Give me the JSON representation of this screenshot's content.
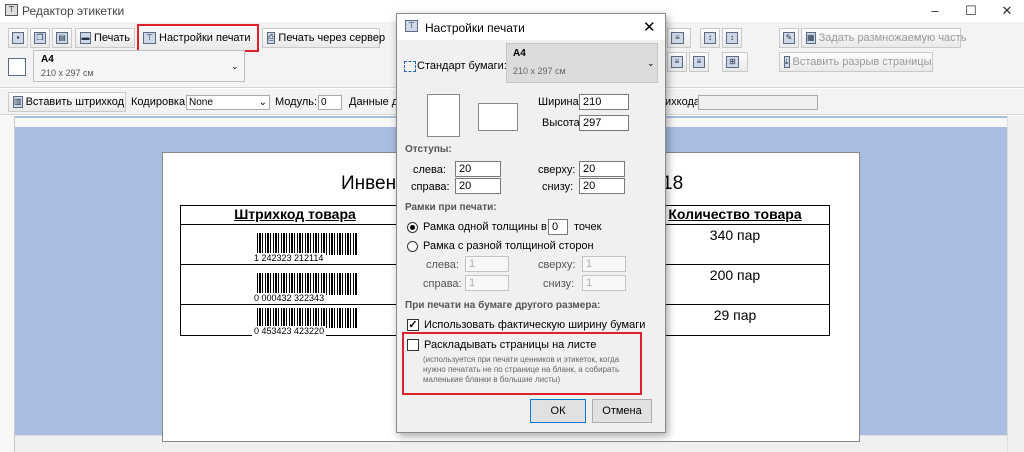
{
  "window": {
    "title": "Редактор этикетки",
    "controls": [
      "–",
      "☐",
      "✕"
    ]
  },
  "toolbar": {
    "print_label": "Печать",
    "print_settings_label": "Настройки печати",
    "print_server_label": "Печать через сервер",
    "paper_name": "A4",
    "paper_size": "210 x 297 см",
    "set_repeat_label": "Задать размножаемую часть",
    "insert_break_label": "Вставить разрыв страницы"
  },
  "toolbar2": {
    "insert_barcode_label": "Вставить штрихкод",
    "encoding_label": "Кодировка:",
    "encoding_value": "None",
    "module_label": "Модуль:",
    "module_value": "0",
    "data_label": "Данные д",
    "barcode_data_label": "ихкода:"
  },
  "document": {
    "title_left": "Инвент",
    "title_right": "18",
    "columns": [
      "Штрихкод товара",
      "Количество товара"
    ],
    "rows": [
      {
        "barcode": "1 242323 212114",
        "qty": "340 пар"
      },
      {
        "barcode": "0 000432 322343",
        "qty": "200 пар"
      },
      {
        "barcode": "0 453423 423220",
        "qty": "29 пар"
      }
    ]
  },
  "dialog": {
    "title": "Настройки печати",
    "paper_standard_label": "Стандарт бумаги:",
    "paper_name": "A4",
    "paper_size": "210 x 297 см",
    "width_label": "Ширина:",
    "width_value": "210",
    "height_label": "Высота:",
    "height_value": "297",
    "margins_section": "Отступы:",
    "left_label": "слева:",
    "left_value": "20",
    "top_label": "сверху:",
    "top_value": "20",
    "right_label": "справа:",
    "right_value": "20",
    "bottom_label": "снизу:",
    "bottom_value": "20",
    "frames_section": "Рамки при печати:",
    "frame_single_label": "Рамка одной толщины в",
    "frame_single_value": "0",
    "frame_single_unit": "точек",
    "frame_multi_label": "Рамка с разной толщиной сторон",
    "frame_left_label": "слева:",
    "frame_left_value": "1",
    "frame_top_label": "сверху:",
    "frame_top_value": "1",
    "frame_right_label": "справа:",
    "frame_right_value": "1",
    "frame_bottom_label": "снизу:",
    "frame_bottom_value": "1",
    "other_paper_section": "При печати на бумаге другого размера:",
    "use_actual_width_label": "Использовать фактическую ширину бумаги",
    "layout_pages_label": "Раскладывать страницы на листе",
    "layout_pages_note": "(используется при печати ценников и этикеток, когда нужно печатать не по странице на бланк, а собирать маленькие бланки в большие листы)",
    "ok_label": "ОК",
    "cancel_label": "Отмена"
  },
  "colors": {
    "highlight": "#e0202a",
    "workspace": "#a9bde0"
  }
}
